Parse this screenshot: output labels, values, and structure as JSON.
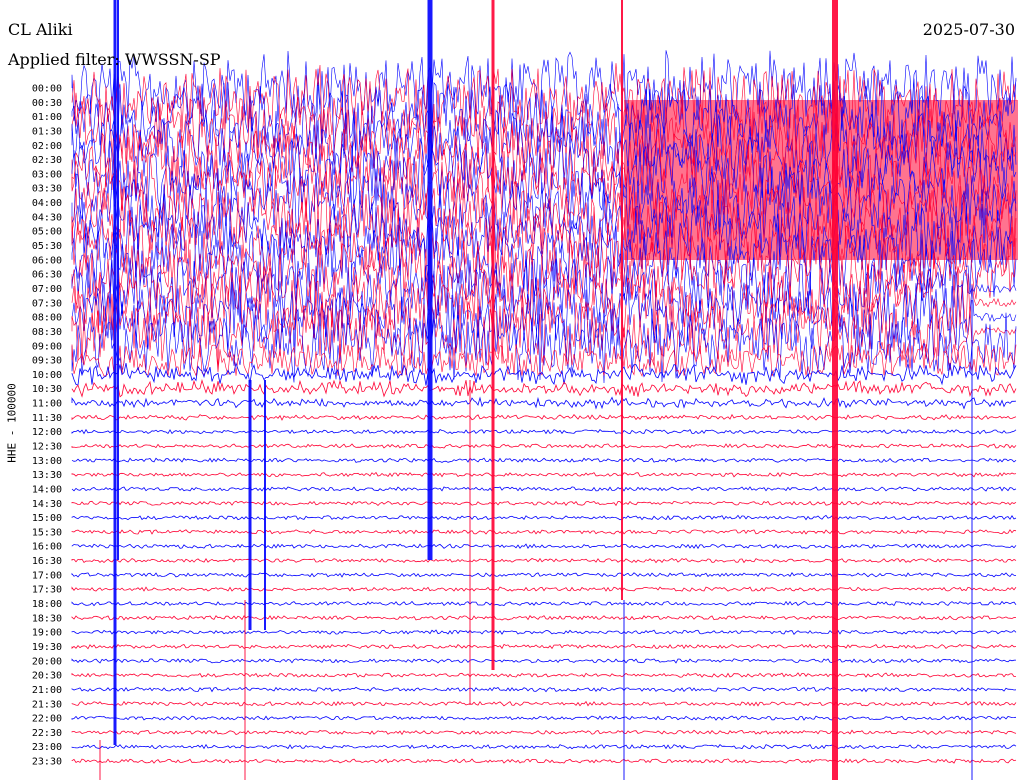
{
  "header": {
    "station": "CL Aliki",
    "filter": "Applied filter: WWSSN-SP",
    "date": "2025-07-30"
  },
  "chart_data": {
    "type": "helicorder",
    "ylabel": "HHE - 100000",
    "time_labels": [
      "00:00",
      "00:30",
      "01:00",
      "01:30",
      "02:00",
      "02:30",
      "03:00",
      "03:30",
      "04:00",
      "04:30",
      "05:00",
      "05:30",
      "06:00",
      "06:30",
      "07:00",
      "07:30",
      "08:00",
      "08:30",
      "09:00",
      "09:30",
      "10:00",
      "10:30",
      "11:00",
      "11:30",
      "12:00",
      "12:30",
      "13:00",
      "13:30",
      "14:00",
      "14:30",
      "15:00",
      "15:30",
      "16:00",
      "16:30",
      "17:00",
      "17:30",
      "18:00",
      "18:30",
      "19:00",
      "19:30",
      "20:00",
      "20:30",
      "21:00",
      "21:30",
      "22:00",
      "22:30",
      "23:00",
      "23:30"
    ],
    "colors": {
      "even": "#0000ff",
      "odd": "#ff0033"
    }
  }
}
